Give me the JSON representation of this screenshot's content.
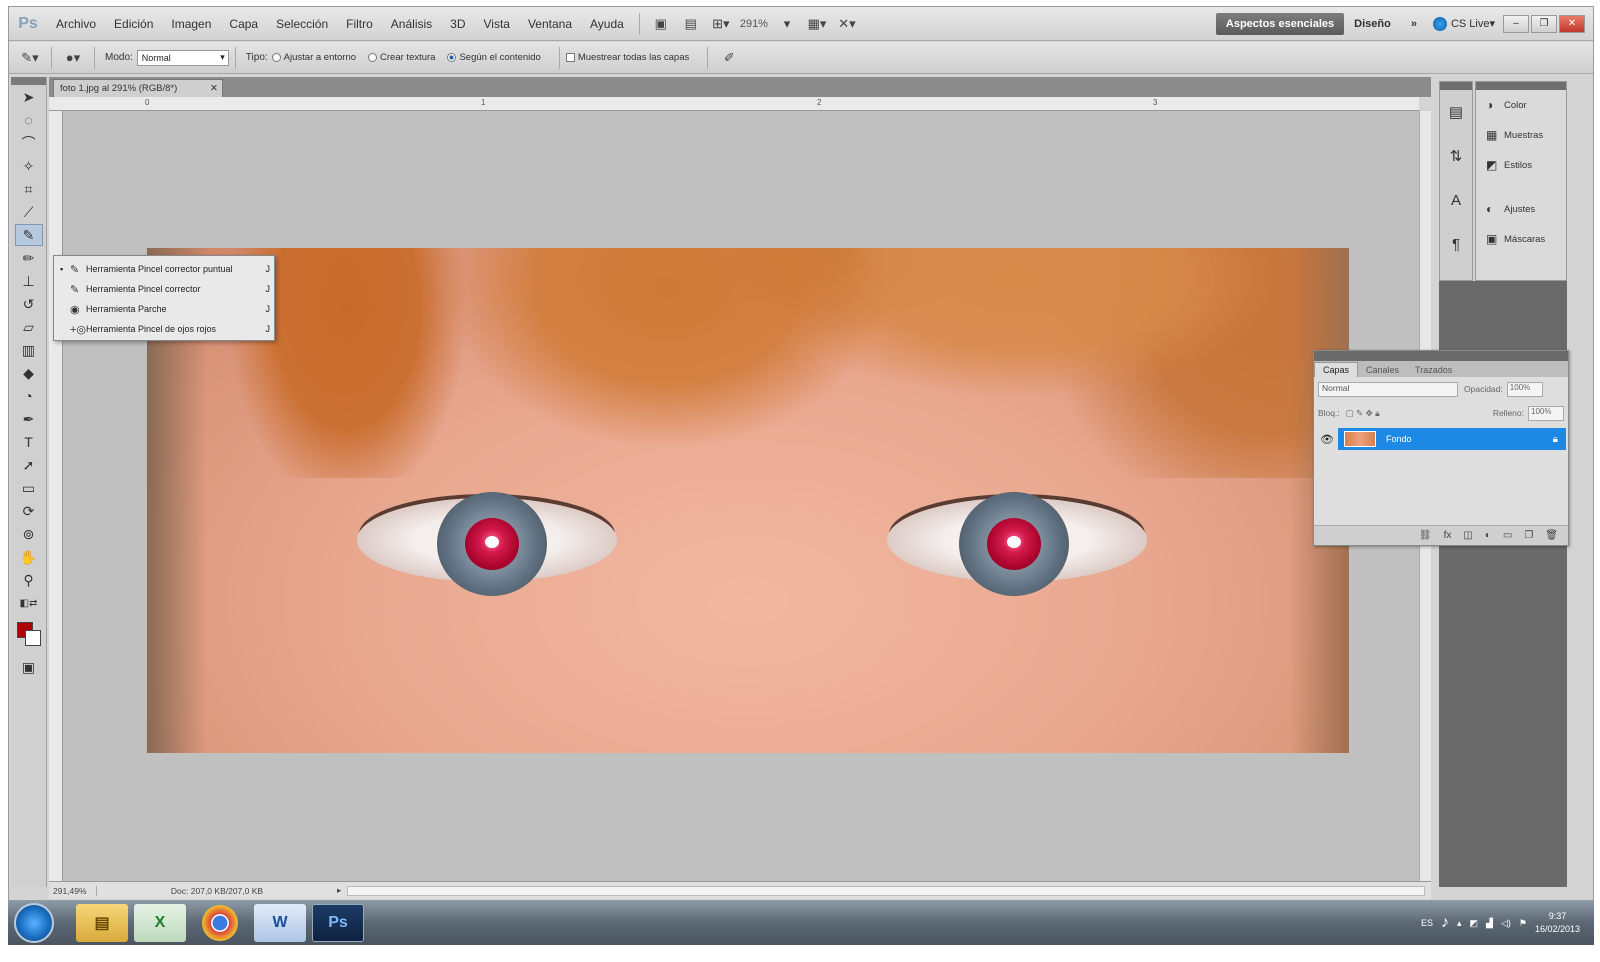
{
  "menubar": {
    "logo": "Ps",
    "items": [
      "Archivo",
      "Edición",
      "Imagen",
      "Capa",
      "Selección",
      "Filtro",
      "Análisis",
      "3D",
      "Vista",
      "Ventana",
      "Ayuda"
    ],
    "zoom": "291%",
    "workspace_active": "Aspectos esenciales",
    "workspace_other": "Diseño",
    "more": "»",
    "cslive": "CS Live"
  },
  "optbar": {
    "mode_label": "Modo:",
    "mode_value": "Normal",
    "type_label": "Tipo:",
    "radio_1": "Ajustar a entorno",
    "radio_2": "Crear textura",
    "radio_3": "Según el contenido",
    "check_sample": "Muestrear todas las capas"
  },
  "document": {
    "tab_title": "foto 1.jpg al 291% (RGB/8*)",
    "ruler_marks": [
      "0",
      "1",
      "2",
      "3"
    ],
    "status_zoom": "291,49%",
    "status_doc": "Doc: 207,0 KB/207,0 KB"
  },
  "flyout": [
    {
      "label": "Herramienta Pincel corrector puntual",
      "key": "J",
      "icon": "spot-healing-brush-icon",
      "active": true
    },
    {
      "label": "Herramienta Pincel corrector",
      "key": "J",
      "icon": "healing-brush-icon",
      "active": false
    },
    {
      "label": "Herramienta Parche",
      "key": "J",
      "icon": "patch-icon",
      "active": false
    },
    {
      "label": "Herramienta Pincel de ojos rojos",
      "key": "J",
      "icon": "red-eye-icon",
      "active": false
    }
  ],
  "dock": {
    "group1": [
      "Color",
      "Muestras",
      "Estilos"
    ],
    "group2": [
      "Ajustes",
      "Máscaras"
    ]
  },
  "layers": {
    "tabs": [
      "Capas",
      "Canales",
      "Trazados"
    ],
    "blend": "Normal",
    "opacity_label": "Opacidad:",
    "opacity": "100%",
    "lock_label": "Bloq.:",
    "fill_label": "Relleno:",
    "fill": "100%",
    "layer_name": "Fondo"
  },
  "taskbar": {
    "lang": "ES",
    "time": "9:37",
    "date": "16/02/2013"
  },
  "colors": {
    "foreground": "#b00000",
    "layer_selected": "#1e88e5"
  }
}
